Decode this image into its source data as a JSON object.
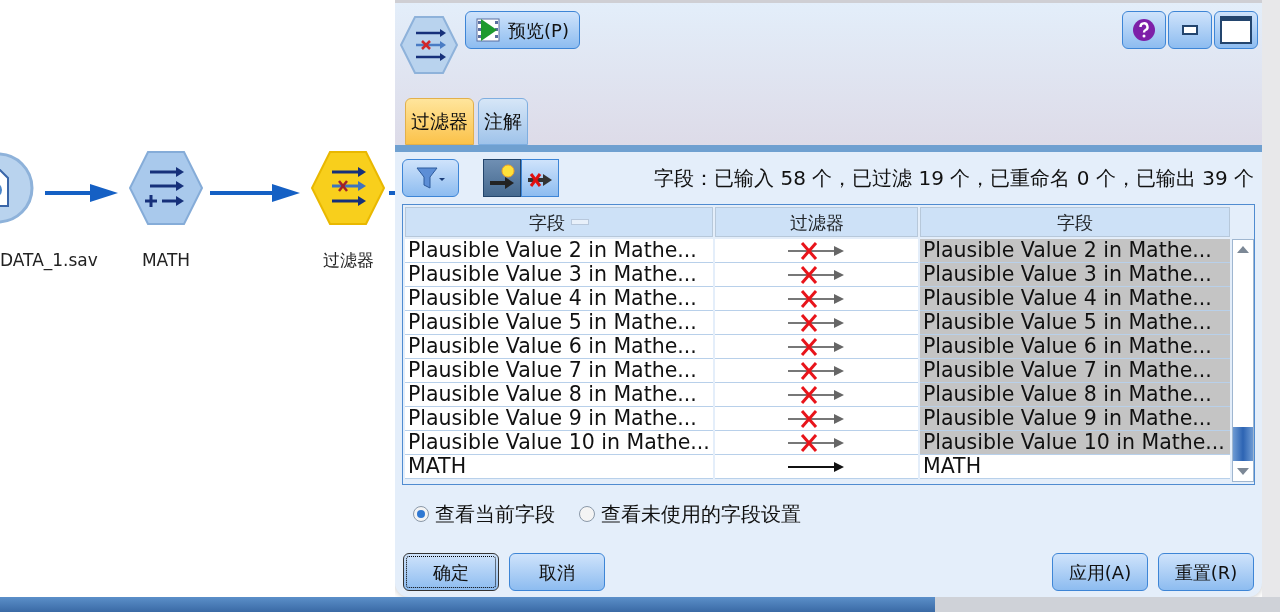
{
  "canvas": {
    "nodes": [
      {
        "kind": "source",
        "label": "DATA_1.sav"
      },
      {
        "kind": "derive",
        "label": "MATH"
      },
      {
        "kind": "filter",
        "label": "过滤器"
      }
    ]
  },
  "dialog": {
    "preview_button": "预览(P)",
    "tabs": [
      {
        "label": "过滤器",
        "selected": true
      },
      {
        "label": "注解",
        "selected": false
      }
    ],
    "toolbar": {
      "toggles": [
        {
          "kind": "new",
          "selected": true
        },
        {
          "kind": "remove",
          "selected": false
        }
      ],
      "summary": "字段：已输入 58 个，已过滤 19 个，已重命名 0 个，已输出 39 个"
    },
    "table": {
      "columns": [
        "字段",
        "过滤器",
        "字段"
      ],
      "rows": [
        {
          "field": "Plausible Value 2 in Mathe...",
          "filtered": true,
          "output": "Plausible Value 2 in Mathe..."
        },
        {
          "field": "Plausible Value 3 in Mathe...",
          "filtered": true,
          "output": "Plausible Value 3 in Mathe..."
        },
        {
          "field": "Plausible Value 4 in Mathe...",
          "filtered": true,
          "output": "Plausible Value 4 in Mathe..."
        },
        {
          "field": "Plausible Value 5 in Mathe...",
          "filtered": true,
          "output": "Plausible Value 5 in Mathe..."
        },
        {
          "field": "Plausible Value 6 in Mathe...",
          "filtered": true,
          "output": "Plausible Value 6 in Mathe..."
        },
        {
          "field": "Plausible Value 7 in Mathe...",
          "filtered": true,
          "output": "Plausible Value 7 in Mathe..."
        },
        {
          "field": "Plausible Value 8 in Mathe...",
          "filtered": true,
          "output": "Plausible Value 8 in Mathe..."
        },
        {
          "field": "Plausible Value 9 in Mathe...",
          "filtered": true,
          "output": "Plausible Value 9 in Mathe..."
        },
        {
          "field": "Plausible Value 10 in Mathe...",
          "filtered": true,
          "output": "Plausible Value 10 in Mathe..."
        },
        {
          "field": "MATH",
          "filtered": false,
          "output": "MATH"
        }
      ]
    },
    "view_options": [
      {
        "label": "查看当前字段",
        "selected": true
      },
      {
        "label": "查看未使用的字段设置",
        "selected": false
      }
    ],
    "buttons_left": [
      "确定",
      "取消"
    ],
    "buttons_right": [
      "应用(A)",
      "重置(R)"
    ]
  }
}
